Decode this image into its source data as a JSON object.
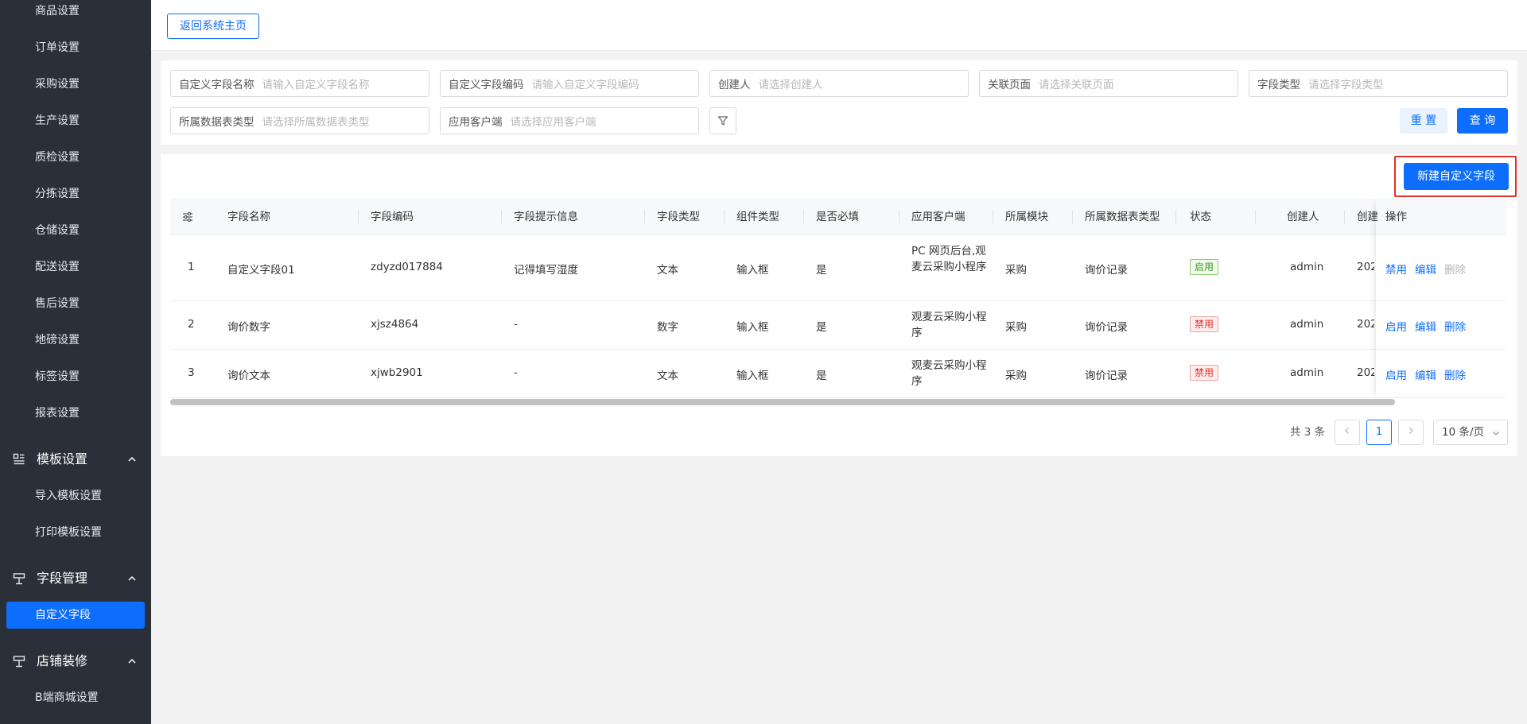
{
  "sidebar": {
    "items_top": [
      "商品设置",
      "订单设置",
      "采购设置",
      "生产设置",
      "质检设置",
      "分拣设置",
      "仓储设置",
      "配送设置",
      "售后设置",
      "地磅设置",
      "标签设置",
      "报表设置"
    ],
    "group_template": {
      "label": "模板设置",
      "children": [
        "导入模板设置",
        "打印模板设置"
      ]
    },
    "group_fields": {
      "label": "字段管理",
      "active_child": "自定义字段"
    },
    "group_shop": {
      "label": "店铺装修",
      "children": [
        "B端商城设置"
      ]
    }
  },
  "topbar": {
    "back_label": "返回系统主页"
  },
  "filters": [
    {
      "label": "自定义字段名称",
      "placeholder": "请输入自定义字段名称"
    },
    {
      "label": "自定义字段编码",
      "placeholder": "请输入自定义字段编码"
    },
    {
      "label": "创建人",
      "placeholder": "请选择创建人"
    },
    {
      "label": "关联页面",
      "placeholder": "请选择关联页面"
    },
    {
      "label": "字段类型",
      "placeholder": "请选择字段类型"
    },
    {
      "label": "所属数据表类型",
      "placeholder": "请选择所属数据表类型"
    },
    {
      "label": "应用客户端",
      "placeholder": "请选择应用客户端"
    }
  ],
  "filter_actions": {
    "reset": "重 置",
    "query": "查 询"
  },
  "table": {
    "new_button": "新建自定义字段",
    "headers": [
      "字段名称",
      "字段编码",
      "字段提示信息",
      "字段类型",
      "组件类型",
      "是否必填",
      "应用客户端",
      "所属模块",
      "所属数据表类型",
      "状态",
      "创建人",
      "创建",
      "操作"
    ],
    "rows": [
      {
        "no": "1",
        "name": "自定义字段01",
        "code": "zdyzd017884",
        "hint": "记得填写湿度",
        "ftype": "文本",
        "ctype": "输入框",
        "required": "是",
        "client": "PC 网页后台,观麦云采购小程序",
        "module": "采购",
        "table_type": "询价记录",
        "status": "启用",
        "status_kind": "on",
        "creator": "admin",
        "created": "202",
        "ops": [
          "禁用",
          "编辑",
          "删除"
        ]
      },
      {
        "no": "2",
        "name": "询价数字",
        "code": "xjsz4864",
        "hint": "-",
        "ftype": "数字",
        "ctype": "输入框",
        "required": "是",
        "client": "观麦云采购小程序",
        "module": "采购",
        "table_type": "询价记录",
        "status": "禁用",
        "status_kind": "off",
        "creator": "admin",
        "created": "202",
        "ops": [
          "启用",
          "编辑",
          "删除"
        ]
      },
      {
        "no": "3",
        "name": "询价文本",
        "code": "xjwb2901",
        "hint": "-",
        "ftype": "文本",
        "ctype": "输入框",
        "required": "是",
        "client": "观麦云采购小程序",
        "module": "采购",
        "table_type": "询价记录",
        "status": "禁用",
        "status_kind": "off",
        "creator": "admin",
        "created": "202",
        "ops": [
          "启用",
          "编辑",
          "删除"
        ]
      }
    ]
  },
  "pagination": {
    "total": "共 3 条",
    "current": "1",
    "page_size": "10 条/页"
  },
  "colors": {
    "primary": "#0d6efd",
    "sidebar_bg": "#2b2f3a",
    "highlight_frame": "#e0302e"
  }
}
